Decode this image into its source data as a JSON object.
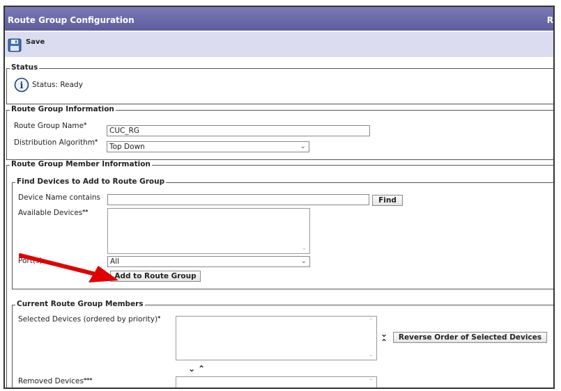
{
  "header": {
    "title": "Route Group Configuration",
    "right_text": "R"
  },
  "toolbar": {
    "save_label": "Save"
  },
  "status": {
    "legend": "Status",
    "text": "Status: Ready"
  },
  "route_group_info": {
    "legend": "Route Group Information",
    "name_label": "Route Group Name",
    "name_value": "CUC_RG",
    "algorithm_label": "Distribution Algorithm",
    "algorithm_value": "Top Down",
    "required_mark": "*"
  },
  "member_info": {
    "legend": "Route Group Member Information"
  },
  "find_devices": {
    "legend": "Find Devices to Add to Route Group",
    "device_name_label": "Device Name contains",
    "device_name_value": "",
    "find_button": "Find",
    "available_label": "Available Devices",
    "available_mark": "**",
    "ports_label": "Port(s)",
    "ports_value": "All",
    "add_button": "Add to Route Group"
  },
  "current_members": {
    "legend": "Current Route Group Members",
    "selected_label": "Selected Devices (ordered by priority)",
    "selected_mark": "*",
    "reverse_button": "Reverse Order of Selected Devices",
    "removed_label": "Removed Devices",
    "removed_mark": "***"
  },
  "icons": {
    "save": "floppy-disk-icon",
    "info": "info-icon",
    "annotation_arrow": "red-arrow"
  },
  "colors": {
    "title_bar": "#5d5d9e",
    "toolbar": "#dcdcf0",
    "annotation": "#e00000"
  }
}
